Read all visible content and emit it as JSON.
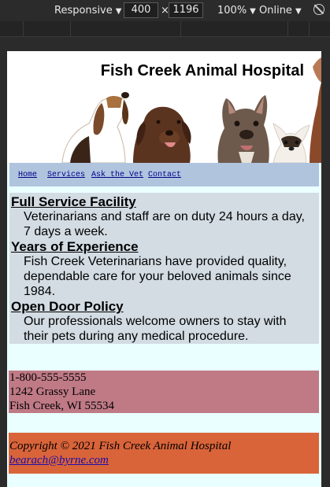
{
  "devtools": {
    "device": "Responsive",
    "width": "400",
    "height": "1196",
    "zoom": "100%",
    "throttle": "Online",
    "rotate_icon": "rotate-icon"
  },
  "site": {
    "title": "Fish Creek Animal Hospital",
    "nav": [
      "Home",
      "Services",
      "Ask the Vet",
      "Contact"
    ],
    "sections": [
      {
        "heading": "Full Service Facility",
        "text": "Veterinarians and staff are on duty 24 hours a day, 7 days a week."
      },
      {
        "heading": "Years of Experience",
        "text": "Fish Creek Veterinarians have provided quality, dependable care for your beloved animals since 1984."
      },
      {
        "heading": "Open Door Policy",
        "text": "Our professionals welcome owners to stay with their pets during any medical procedure."
      }
    ],
    "contact": {
      "phone": "1-800-555-5555",
      "street": "1242 Grassy Lane",
      "city": "Fish Creek, WI 55534"
    },
    "footer": {
      "copyright": "Copyright © 2021 Fish Creek Animal Hospital",
      "email": "bearach@byrne.com"
    },
    "colors": {
      "page_bg": "#eaffff",
      "nav_bg": "#b0c4de",
      "main_bg": "#d3dce3",
      "contact_bg": "#bf7a86",
      "footer_bg": "#d9643a"
    }
  }
}
